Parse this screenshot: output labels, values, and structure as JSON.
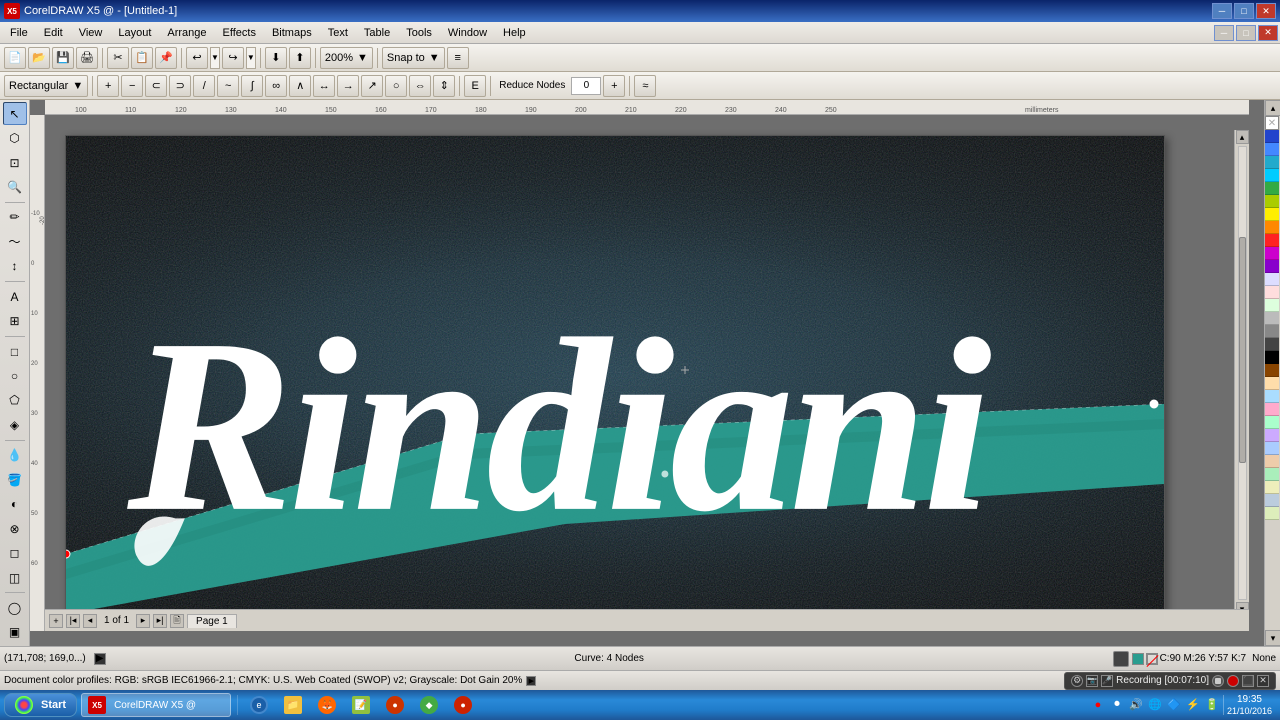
{
  "titleBar": {
    "title": "CorelDRAW X5 @ - [Untitled-1]",
    "appIcon": "CDR",
    "minBtn": "─",
    "maxBtn": "□",
    "closeBtn": "✕",
    "innerMin": "─",
    "innerMax": "□",
    "innerClose": "✕"
  },
  "menuBar": {
    "items": [
      "File",
      "Edit",
      "View",
      "Layout",
      "Arrange",
      "Effects",
      "Bitmaps",
      "Text",
      "Table",
      "Tools",
      "Window",
      "Help"
    ]
  },
  "toolbar1": {
    "zoom": "200%",
    "snapTo": "Snap to",
    "buttons": [
      "new",
      "open",
      "save",
      "print",
      "cut",
      "copy",
      "paste",
      "undo",
      "redo",
      "import",
      "export",
      "app-launcher",
      "corel-launcher"
    ]
  },
  "toolbar2": {
    "shapeSelector": "Rectangular",
    "reduceNodes": "Reduce Nodes",
    "nodesValue": "0"
  },
  "canvas": {
    "rulerUnits": "millimeters",
    "rulerMarks": [
      "100",
      "110",
      "120",
      "130",
      "140",
      "150",
      "160",
      "170",
      "180",
      "190",
      "200",
      "210",
      "220",
      "230",
      "240",
      "250"
    ]
  },
  "artwork": {
    "title": "Rindiani",
    "description": "Script lettering on dark textured background with teal swoosh"
  },
  "statusBar": {
    "coordinates": "(171,708; 169,0...)",
    "curveInfo": "Curve: 4 Nodes",
    "colorProfile": "Document color profiles: RGB: sRGB IEC61966-2.1; CMYK: U.S. Web Coated (SWOP) v2; Grayscale: Dot Gain 20%",
    "colorValues": "C:90 M:26 Y:57 K:7",
    "fillColor": "None",
    "fillLabel": "None"
  },
  "pageNav": {
    "current": "1 of 1",
    "pageName": "Page 1"
  },
  "recording": {
    "label": "Recording [00:07:10]"
  },
  "palette": {
    "colors": [
      "#FFFFFF",
      "#000000",
      "#FF0000",
      "#00FF00",
      "#0000FF",
      "#FFFF00",
      "#FF00FF",
      "#00FFFF",
      "#FF8800",
      "#8800FF",
      "#0088FF",
      "#FF0088",
      "#88FF00",
      "#00FF88",
      "#884400",
      "#004488",
      "#FF6666",
      "#66FF66",
      "#6666FF",
      "#FFFF66",
      "#FF66FF",
      "#66FFFF",
      "#888888",
      "#444444",
      "#FFDDDD",
      "#DDFFDD",
      "#DDDDFF",
      "#FFFFDD",
      "#FFDDFF",
      "#DDFFFF",
      "#CCCCCC",
      "#AAAAAA"
    ]
  },
  "taskbar": {
    "startLabel": "Start",
    "apps": [
      "CorelDRAW",
      "IE",
      "Explorer",
      "Firefox",
      "Notepad",
      "Other"
    ],
    "time": "19:35",
    "date": "21/10/2016"
  }
}
